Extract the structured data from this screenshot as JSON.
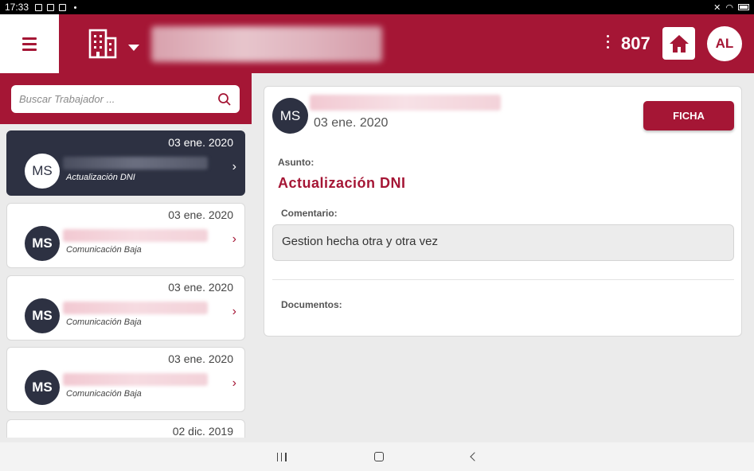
{
  "status_bar": {
    "time": "17:33"
  },
  "header": {
    "counter": "807",
    "user_initials": "AL",
    "menu_icon": "hamburger-icon",
    "company_icon": "building-icon",
    "home_icon": "home-icon",
    "accent_color": "#a51635"
  },
  "search": {
    "placeholder": "Buscar Trabajador ..."
  },
  "list_items": [
    {
      "date": "03 ene. 2020",
      "initials": "MS",
      "subject": "Actualización DNI",
      "active": true
    },
    {
      "date": "03 ene. 2020",
      "initials": "MS",
      "subject": "Comunicación Baja",
      "active": false
    },
    {
      "date": "03 ene. 2020",
      "initials": "MS",
      "subject": "Comunicación Baja",
      "active": false
    },
    {
      "date": "03 ene. 2020",
      "initials": "MS",
      "subject": "Comunicación Baja",
      "active": false
    },
    {
      "date": "02 dic. 2019",
      "initials": "",
      "subject": "",
      "active": false
    }
  ],
  "detail": {
    "initials": "MS",
    "date": "03 ene. 2020",
    "ficha_label": "FICHA",
    "asunto_label": "Asunto:",
    "asunto_value": "Actualización DNI",
    "comentario_label": "Comentario:",
    "comentario_value": "Gestion hecha otra y otra vez",
    "documentos_label": "Documentos:"
  }
}
